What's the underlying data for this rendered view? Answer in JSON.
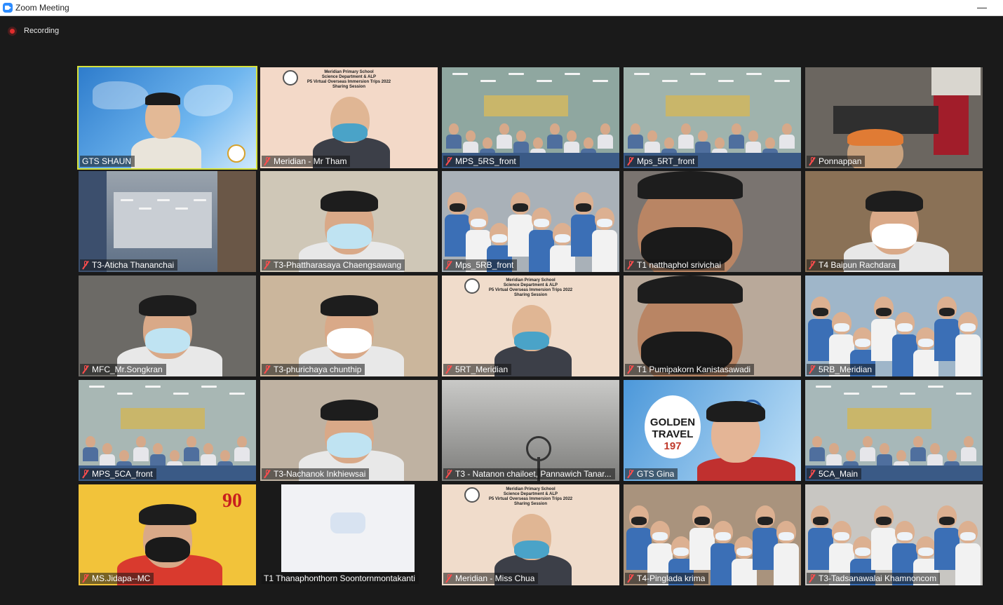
{
  "window": {
    "title": "Zoom Meeting",
    "minimize": "—"
  },
  "recording": {
    "label": "Recording"
  },
  "participants": [
    {
      "name": "GTS SHAUN",
      "muted": false,
      "active": true,
      "bg": "#3f8fd6",
      "scene": "map"
    },
    {
      "name": "Meridian - Mr Tham",
      "muted": true,
      "bg": "#f3d9c8",
      "scene": "slide"
    },
    {
      "name": "MPS_5RS_front",
      "muted": true,
      "bg": "#8fa7a0",
      "scene": "classroom"
    },
    {
      "name": "Mps_5RT_front",
      "muted": true,
      "bg": "#9fb3ad",
      "scene": "classroom"
    },
    {
      "name": "Ponnappan",
      "muted": true,
      "bg": "#6b6660",
      "scene": "room"
    },
    {
      "name": "T3-Aticha Thananchai",
      "muted": true,
      "bg": "#5d6f86",
      "scene": "library"
    },
    {
      "name": "T3-Phattharasaya Chaengsawang",
      "muted": true,
      "bg": "#cfc7b7",
      "scene": "person"
    },
    {
      "name": "Mps_5RB_front",
      "muted": true,
      "bg": "#a9b1b8",
      "scene": "crowd"
    },
    {
      "name": "T1 natthaphol srivichai",
      "muted": true,
      "bg": "#7a7470",
      "scene": "closeup"
    },
    {
      "name": "T4 Baipun Rachdara",
      "muted": true,
      "bg": "#8a7156",
      "scene": "person"
    },
    {
      "name": "MFC_Mr.Songkran",
      "muted": true,
      "bg": "#6c6a66",
      "scene": "person"
    },
    {
      "name": "T3-phurichaya chunthip",
      "muted": true,
      "bg": "#cbb69c",
      "scene": "person"
    },
    {
      "name": "5RT_Meridian",
      "muted": true,
      "bg": "#f0dccb",
      "scene": "slide"
    },
    {
      "name": "T1 Pumipakorn Kanistasawadi",
      "muted": true,
      "bg": "#b9a99a",
      "scene": "closeup"
    },
    {
      "name": "5RB_Meridian",
      "muted": true,
      "bg": "#9fb6c9",
      "scene": "crowd"
    },
    {
      "name": "MPS_5CA_front",
      "muted": true,
      "bg": "#a8b7b4",
      "scene": "classroom"
    },
    {
      "name": "T3-Nachanok Inkhiewsai",
      "muted": true,
      "bg": "#bfb2a2",
      "scene": "person"
    },
    {
      "name": "T3 - Natanon chailoet, Pannawich Tanar...",
      "muted": true,
      "bg": "#8c8c8a",
      "scene": "ceiling"
    },
    {
      "name": "GTS Gina",
      "muted": true,
      "bg": "#5aa0dc",
      "scene": "logo"
    },
    {
      "name": "5CA_Main",
      "muted": true,
      "bg": "#a7b8b9",
      "scene": "classroom"
    },
    {
      "name": "MS.Jidapa--MC",
      "muted": true,
      "bg": "#f2c33a",
      "scene": "person"
    },
    {
      "name": "T1 Thanaphonthorn Soontornmontakanti",
      "muted": false,
      "bg": "#1a1a1a",
      "scene": "shirt"
    },
    {
      "name": "Meridian - Miss Chua",
      "muted": true,
      "bg": "#f0dccb",
      "scene": "slide"
    },
    {
      "name": "T4-Pinglada krima",
      "muted": true,
      "bg": "#a9937d",
      "scene": "crowd"
    },
    {
      "name": "T3-Tadsanawalai Khamnoncom",
      "muted": true,
      "bg": "#c8c6c2",
      "scene": "crowd"
    }
  ],
  "slide_text": {
    "line1": "Meridian Primary School",
    "line2": "Science Department & ALP",
    "line3": "P5 Virtual Overseas Immersion Trips 2022",
    "line4": "Sharing Session"
  },
  "brand": {
    "logo_line1": "GOLDEN",
    "logo_line2": "TRAVEL",
    "year": "197",
    "number": "90"
  },
  "colors": {
    "active_border": "#d6e23a",
    "muted_icon": "#ff4d4d",
    "recording": "#e02d2d",
    "zoom_blue": "#2d8cff"
  }
}
